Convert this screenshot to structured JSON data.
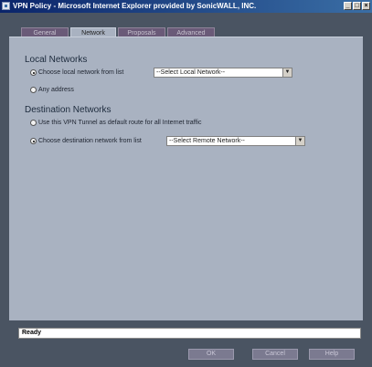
{
  "window": {
    "title": "VPN Policy - Microsoft Internet Explorer provided by SonicWALL, INC.",
    "controls": [
      "_",
      "□",
      "×"
    ]
  },
  "tabs": [
    {
      "label": "General",
      "active": false
    },
    {
      "label": "Network",
      "active": true
    },
    {
      "label": "Proposals",
      "active": false
    },
    {
      "label": "Advanced",
      "active": false
    }
  ],
  "local": {
    "heading": "Local Networks",
    "option_list": {
      "label": "Choose local network from list",
      "checked": true
    },
    "select_value": "--Select Local Network--",
    "option_any": {
      "label": "Any address",
      "checked": false
    }
  },
  "destination": {
    "heading": "Destination Networks",
    "option_default": {
      "label": "Use this VPN Tunnel as default route for all Internet traffic",
      "checked": false
    },
    "option_list": {
      "label": "Choose destination network from list",
      "checked": true
    },
    "select_value": "--Select Remote Network--"
  },
  "status": {
    "text": "Ready"
  },
  "buttons": {
    "ok": "OK",
    "cancel": "Cancel",
    "help": "Help"
  }
}
